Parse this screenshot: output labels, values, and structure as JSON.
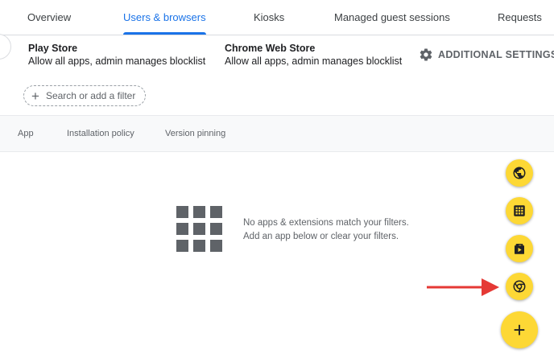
{
  "tabs": [
    {
      "label": "Overview",
      "active": false
    },
    {
      "label": "Users & browsers",
      "active": true
    },
    {
      "label": "Kiosks",
      "active": false
    },
    {
      "label": "Managed guest sessions",
      "active": false
    },
    {
      "label": "Requests",
      "active": false
    }
  ],
  "stores": {
    "play": {
      "title": "Play Store",
      "desc": "Allow all apps, admin manages blocklist"
    },
    "chrome": {
      "title": "Chrome Web Store",
      "desc": "Allow all apps, admin manages blocklist"
    }
  },
  "settings": {
    "label": "ADDITIONAL SETTINGS",
    "icon": "gear-icon"
  },
  "filter": {
    "placeholder": "Search or add a filter",
    "icon": "plus-icon"
  },
  "table": {
    "columns": [
      "App",
      "Installation policy",
      "Version pinning"
    ]
  },
  "empty_state": {
    "icon": "apps-grid-icon",
    "line1": "No apps & extensions match your filters.",
    "line2": "Add an app below or clear your filters."
  },
  "fabs": [
    {
      "icon": "globe-icon"
    },
    {
      "icon": "apps-icon"
    },
    {
      "icon": "play-store-icon"
    },
    {
      "icon": "chrome-icon"
    },
    {
      "icon": "plus-icon",
      "label": "+"
    }
  ],
  "colors": {
    "accent": "#1a73e8",
    "fab": "#fdd835",
    "arrow": "#e53935"
  }
}
